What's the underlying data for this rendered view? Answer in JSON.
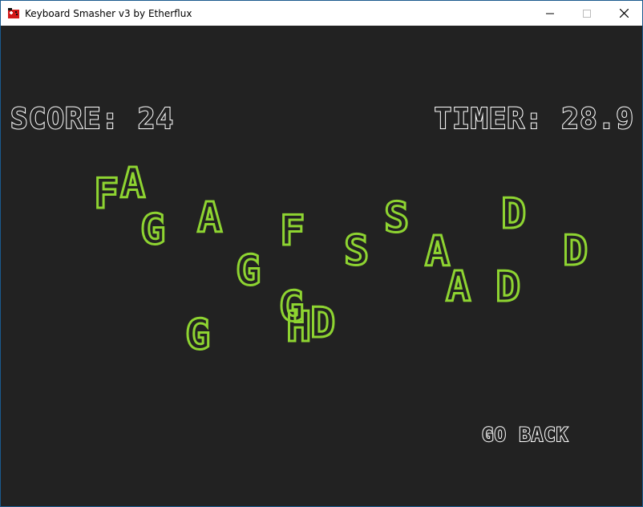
{
  "window": {
    "title": "Keyboard Smasher v3 by Etherflux",
    "icon": "red-game-controller-icon",
    "controls": [
      "minimize-icon",
      "maximize-icon",
      "close-icon"
    ]
  },
  "hud": {
    "score_text": "SCORE: 24",
    "timer_text": "TIMER: 28.9"
  },
  "menu": {
    "go_back_label": "GO BACK"
  },
  "letters": [
    "F",
    "A",
    "G",
    "A",
    "F",
    "S",
    "D",
    "G",
    "S",
    "A",
    "D",
    "A",
    "D",
    "G",
    "H",
    "D",
    "G"
  ],
  "colors": {
    "background": "#222222",
    "letter_outline": "#8ed431",
    "hud_outline": "#ffffff",
    "titlebar": "#ffffff"
  }
}
